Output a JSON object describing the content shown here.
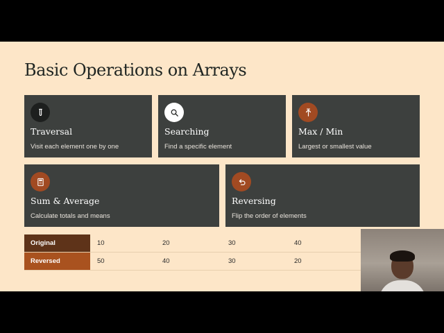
{
  "slide": {
    "title": "Basic Operations on Arrays",
    "cards": [
      {
        "title": "Traversal",
        "desc": "Visit each element one by one",
        "icon": "test-tube-icon"
      },
      {
        "title": "Searching",
        "desc": "Find a specific element",
        "icon": "search-icon"
      },
      {
        "title": "Max / Min",
        "desc": "Largest or smallest value",
        "icon": "upload-arrow-icon"
      },
      {
        "title": "Sum & Average",
        "desc": "Calculate totals and means",
        "icon": "calculator-icon"
      },
      {
        "title": "Reversing",
        "desc": "Flip the order of elements",
        "icon": "undo-arrow-icon"
      }
    ],
    "table": {
      "rows": [
        {
          "label": "Original",
          "values": [
            "10",
            "20",
            "30",
            "40"
          ]
        },
        {
          "label": "Reversed",
          "values": [
            "50",
            "40",
            "30",
            "20"
          ]
        }
      ]
    }
  },
  "colors": {
    "background": "#fde6c8",
    "card": "#3d403e",
    "accent": "#a14a22",
    "original_label": "#5e3319",
    "reversed_label": "#a9521f"
  }
}
